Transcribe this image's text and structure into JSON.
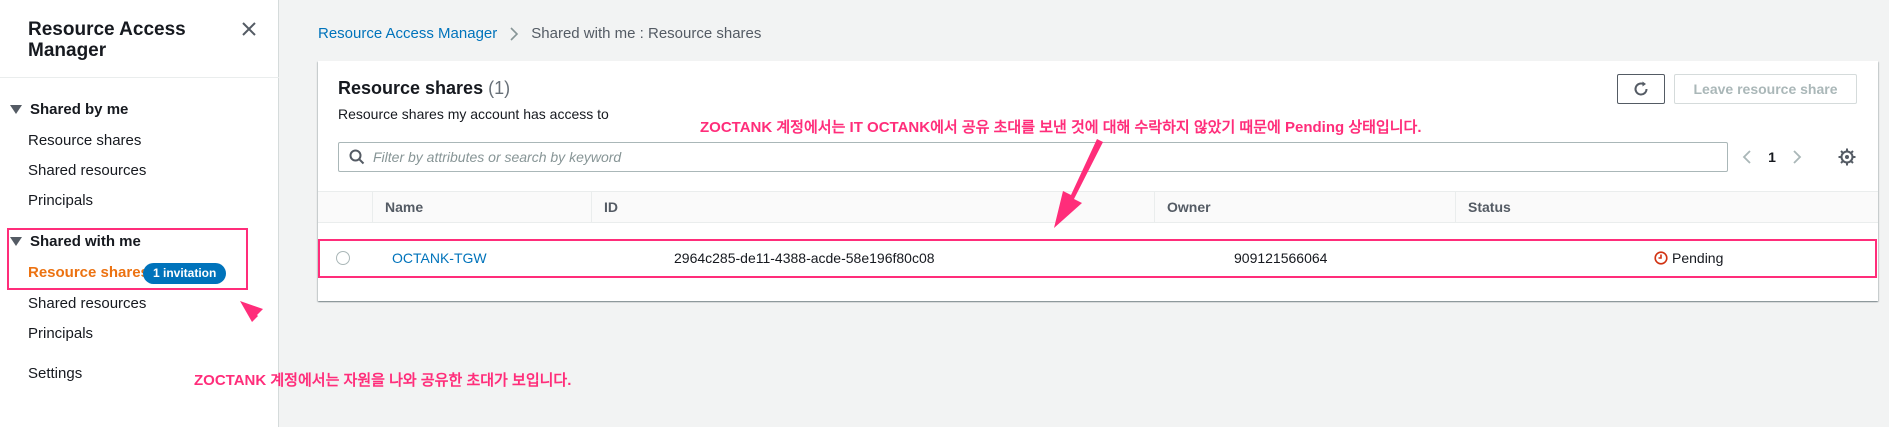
{
  "sidebar": {
    "title": "Resource Access Manager",
    "sections": [
      {
        "label": "Shared by me",
        "items": [
          "Resource shares",
          "Shared resources",
          "Principals"
        ]
      },
      {
        "label": "Shared with me",
        "items": [
          "Resource shares",
          "Shared resources",
          "Principals"
        ],
        "active_item": "Resource shares",
        "badge": "1 invitation"
      }
    ],
    "settings_label": "Settings"
  },
  "breadcrumb": {
    "root": "Resource Access Manager",
    "current": "Shared with me : Resource shares"
  },
  "panel": {
    "title": "Resource shares",
    "count": "(1)",
    "description": "Resource shares my account has access to",
    "leave_button": "Leave resource share",
    "search_placeholder": "Filter by attributes or search by keyword",
    "page": "1"
  },
  "table": {
    "columns": [
      "Name",
      "ID",
      "Owner",
      "Status"
    ],
    "rows": [
      {
        "name": "OCTANK-TGW",
        "id": "2964c285-de11-4388-acde-58e196f80c08",
        "owner": "909121566064",
        "status": "Pending"
      }
    ]
  },
  "annotations": {
    "top": "ZOCTANK 계정에서는 IT OCTANK에서 공유 초대를 보낸 것에 대해 수락하지 않았기 때문에 Pending 상태입니다.",
    "bottom": "ZOCTANK 계정에서는 자원을 나와 공유한 초대가 보입니다."
  },
  "colors": {
    "accent_orange": "#ec7211",
    "link_blue": "#0073bb",
    "annotation_pink": "#ff2d7a",
    "pending_red": "#d13212"
  },
  "icons": [
    "close-icon",
    "chevron-right-icon",
    "refresh-icon",
    "search-icon",
    "chevron-left-icon",
    "gear-icon",
    "pending-clock-icon"
  ]
}
